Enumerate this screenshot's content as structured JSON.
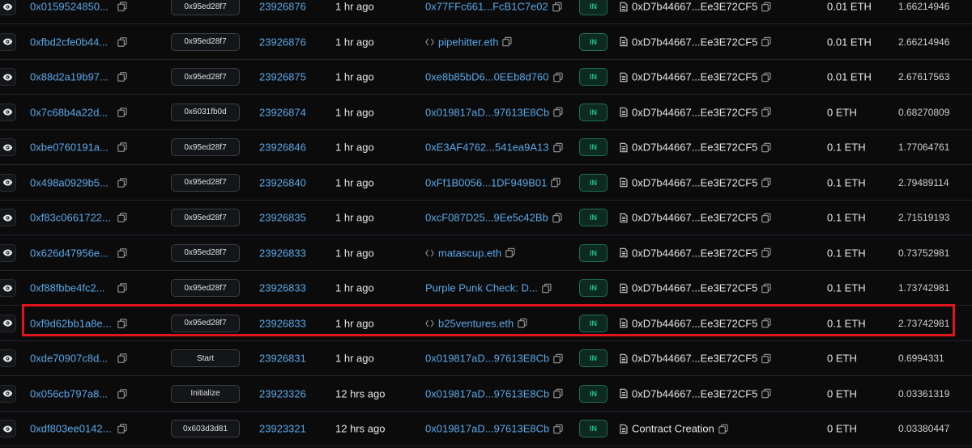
{
  "rows": [
    {
      "hash": "0x0159524850...",
      "method": "0x95ed28f7",
      "block": "23926876",
      "age": "1 hr ago",
      "from": "0x77FFc661...FcB1C7e02",
      "from_ens": false,
      "direction": "IN",
      "to": "0xD7b44667...Ee3E72CF5",
      "value": "0.01 ETH",
      "fee": "1.66214946"
    },
    {
      "hash": "0xfbd2cfe0b44...",
      "method": "0x95ed28f7",
      "block": "23926876",
      "age": "1 hr ago",
      "from": "pipehitter.eth",
      "from_ens": true,
      "direction": "IN",
      "to": "0xD7b44667...Ee3E72CF5",
      "value": "0.01 ETH",
      "fee": "2.66214946"
    },
    {
      "hash": "0x88d2a19b97...",
      "method": "0x95ed28f7",
      "block": "23926875",
      "age": "1 hr ago",
      "from": "0xe8b85bD6...0EEb8d760",
      "from_ens": false,
      "direction": "IN",
      "to": "0xD7b44667...Ee3E72CF5",
      "value": "0.01 ETH",
      "fee": "2.67617563"
    },
    {
      "hash": "0x7c68b4a22d...",
      "method": "0x6031fb0d",
      "block": "23926874",
      "age": "1 hr ago",
      "from": "0x019817aD...97613E8Cb",
      "from_ens": false,
      "direction": "IN",
      "to": "0xD7b44667...Ee3E72CF5",
      "value": "0 ETH",
      "fee": "0.68270809"
    },
    {
      "hash": "0xbe0760191a...",
      "method": "0x95ed28f7",
      "block": "23926846",
      "age": "1 hr ago",
      "from": "0xE3AF4762...541ea9A13",
      "from_ens": false,
      "direction": "IN",
      "to": "0xD7b44667...Ee3E72CF5",
      "value": "0.1 ETH",
      "fee": "1.77064761"
    },
    {
      "hash": "0x498a0929b5...",
      "method": "0x95ed28f7",
      "block": "23926840",
      "age": "1 hr ago",
      "from": "0xFf1B0056...1DF949B01",
      "from_ens": false,
      "direction": "IN",
      "to": "0xD7b44667...Ee3E72CF5",
      "value": "0.1 ETH",
      "fee": "2.79489114"
    },
    {
      "hash": "0xf83c0661722...",
      "method": "0x95ed28f7",
      "block": "23926835",
      "age": "1 hr ago",
      "from": "0xcF087D25...9Ee5c42Bb",
      "from_ens": false,
      "direction": "IN",
      "to": "0xD7b44667...Ee3E72CF5",
      "value": "0.1 ETH",
      "fee": "2.71519193"
    },
    {
      "hash": "0x626d47956e...",
      "method": "0x95ed28f7",
      "block": "23926833",
      "age": "1 hr ago",
      "from": "matascup.eth",
      "from_ens": true,
      "direction": "IN",
      "to": "0xD7b44667...Ee3E72CF5",
      "value": "0.1 ETH",
      "fee": "0.73752981"
    },
    {
      "hash": "0xf88fbbe4fc2...",
      "method": "0x95ed28f7",
      "block": "23926833",
      "age": "1 hr ago",
      "from": "Purple Punk Check: D...",
      "from_ens": false,
      "direction": "IN",
      "to": "0xD7b44667...Ee3E72CF5",
      "value": "0.1 ETH",
      "fee": "1.73742981"
    },
    {
      "hash": "0xf9d62bb1a8e...",
      "method": "0x95ed28f7",
      "block": "23926833",
      "age": "1 hr ago",
      "from": "b25ventures.eth",
      "from_ens": true,
      "direction": "IN",
      "to": "0xD7b44667...Ee3E72CF5",
      "value": "0.1 ETH",
      "fee": "2.73742981"
    },
    {
      "hash": "0xde70907c8d...",
      "method": "Start",
      "block": "23926831",
      "age": "1 hr ago",
      "from": "0x019817aD...97613E8Cb",
      "from_ens": false,
      "direction": "IN",
      "to": "0xD7b44667...Ee3E72CF5",
      "value": "0 ETH",
      "fee": "0.6994331"
    },
    {
      "hash": "0x056cb797a8...",
      "method": "Initialize",
      "block": "23923326",
      "age": "12 hrs ago",
      "from": "0x019817aD...97613E8Cb",
      "from_ens": false,
      "direction": "IN",
      "to": "0xD7b44667...Ee3E72CF5",
      "value": "0 ETH",
      "fee": "0.03361319"
    },
    {
      "hash": "0xdf803ee0142...",
      "method": "0x603d3d81",
      "block": "23923321",
      "age": "12 hrs ago",
      "from": "0x019817aD...97613E8Cb",
      "from_ens": false,
      "direction": "IN",
      "to": "Contract Creation",
      "value": "0 ETH",
      "fee": "0.03380447"
    }
  ],
  "colors": {
    "link": "#5aa8e6",
    "in_badge": "#21c08a",
    "highlight": "#e0141c"
  },
  "icons": {
    "view": "eye-icon",
    "copy": "copy-icon",
    "ens": "ens-icon",
    "contract": "document-icon"
  }
}
